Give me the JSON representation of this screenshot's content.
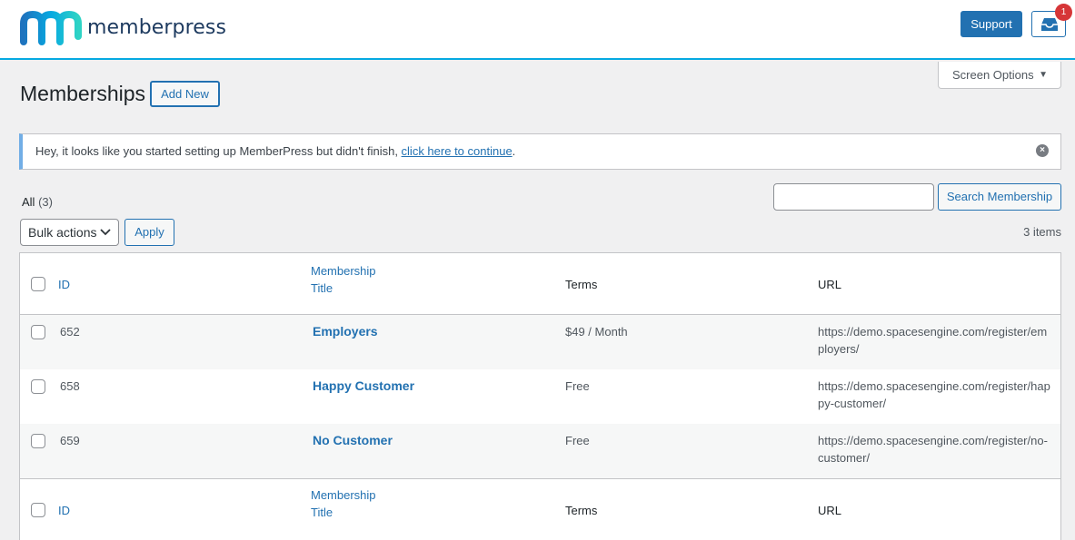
{
  "header": {
    "logo_text": "memberpress",
    "support_label": "Support",
    "notification_count": "1"
  },
  "screen_options": {
    "label": "Screen Options"
  },
  "page": {
    "title": "Memberships",
    "add_new_label": "Add New"
  },
  "notice": {
    "text": "Hey, it looks like you started setting up MemberPress but didn't finish, ",
    "link_text": "click here to continue",
    "trailing": "."
  },
  "views": {
    "all_label": "All",
    "all_count": "(3)"
  },
  "search": {
    "value": "",
    "button_label": "Search Membership"
  },
  "bulk": {
    "selected": "Bulk actions",
    "apply_label": "Apply",
    "items_count": "3 items"
  },
  "table": {
    "columns": {
      "id": "ID",
      "title_line1": "Membership",
      "title_line2": "Title",
      "terms": "Terms",
      "url": "URL"
    },
    "rows": [
      {
        "id": "652",
        "title": "Employers",
        "terms": "$49 / Month",
        "url": "https://demo.spacesengine.com/register/employers/"
      },
      {
        "id": "658",
        "title": "Happy Customer",
        "terms": "Free",
        "url": "https://demo.spacesengine.com/register/happy-customer/"
      },
      {
        "id": "659",
        "title": "No Customer",
        "terms": "Free",
        "url": "https://demo.spacesengine.com/register/no-customer/"
      }
    ]
  },
  "colors": {
    "accent": "#2271b1",
    "brand_cyan": "#06a9e1",
    "notice_border": "#72aee6",
    "badge": "#d63638"
  }
}
